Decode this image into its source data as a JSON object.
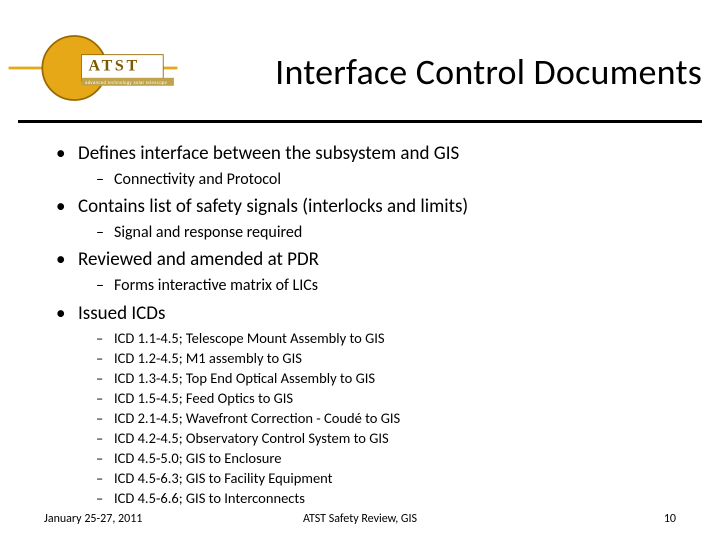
{
  "header": {
    "title": "Interface Control Documents",
    "logo": {
      "brand_top": "ATST",
      "brand_sub": "advanced technology solar telescope",
      "accent_color": "#E6A817",
      "ring_color": "#9a6a00"
    }
  },
  "bullets": [
    {
      "text": "Defines interface between the subsystem and GIS",
      "sub": [
        {
          "text": "Connectivity and Protocol"
        }
      ]
    },
    {
      "text": "Contains list of safety signals (interlocks and limits)",
      "sub": [
        {
          "text": "Signal and response required"
        }
      ]
    },
    {
      "text": "Reviewed and amended at PDR",
      "sub": [
        {
          "text": "Forms interactive matrix of LICs"
        }
      ]
    },
    {
      "text": "Issued ICDs",
      "sub": [
        {
          "text": "ICD 1.1-4.5; Telescope Mount Assembly to GIS"
        },
        {
          "text": "ICD 1.2-4.5; M1 assembly to GIS"
        },
        {
          "text": "ICD 1.3-4.5; Top End Optical Assembly to GIS"
        },
        {
          "text": "ICD 1.5-4.5; Feed Optics to GIS"
        },
        {
          "text": "ICD 2.1-4.5; Wavefront Correction - Coudé to GIS"
        },
        {
          "text": "ICD 4.2-4.5; Observatory Control System to GIS"
        },
        {
          "text": "ICD 4.5-5.0; GIS to Enclosure"
        },
        {
          "text": "ICD 4.5-6.3; GIS to Facility Equipment"
        },
        {
          "text": "ICD 4.5-6.6; GIS to Interconnects"
        }
      ]
    }
  ],
  "footer": {
    "date": "January 25-27, 2011",
    "center": "ATST Safety Review, GIS",
    "pagenum": "10"
  }
}
